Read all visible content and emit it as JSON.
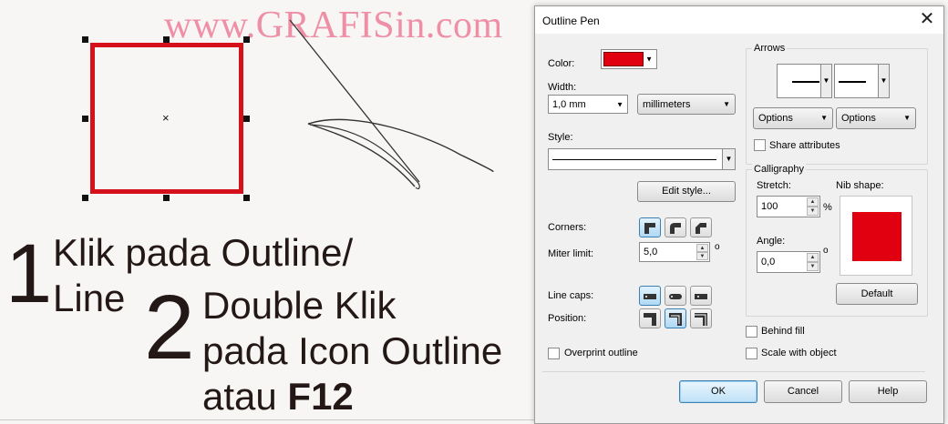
{
  "watermark": "www.GRAFISin.com",
  "tutorial": {
    "step1_number": "1",
    "step1_line1": "Klik pada Outline/",
    "step1_line2": "Line",
    "step2_number": "2",
    "step2_line1": "Double Klik",
    "step2_line2": "pada Icon Outline",
    "step2_line3_prefix": "atau ",
    "step2_line3_key": "F12",
    "center_mark": "×"
  },
  "dialog": {
    "title": "Outline Pen",
    "close_glyph": "✕",
    "color_label": "Color:",
    "color_value": "#e00010",
    "width_label": "Width:",
    "width_value": "1,0 mm",
    "units_value": "millimeters",
    "style_label": "Style:",
    "edit_style_button": "Edit style...",
    "corners_label": "Corners:",
    "miter_label": "Miter limit:",
    "miter_value": "5,0",
    "miter_unit": "o",
    "line_caps_label": "Line caps:",
    "position_label": "Position:",
    "overprint_label": "Overprint outline",
    "arrows_title": "Arrows",
    "options_left": "Options",
    "options_right": "Options",
    "share_attributes": "Share attributes",
    "calligraphy_title": "Calligraphy",
    "stretch_label": "Stretch:",
    "stretch_value": "100",
    "stretch_unit": "%",
    "nib_shape_label": "Nib shape:",
    "angle_label": "Angle:",
    "angle_value": "0,0",
    "angle_unit": "o",
    "default_button": "Default",
    "behind_fill": "Behind fill",
    "scale_with_object": "Scale with object",
    "ok_button": "OK",
    "cancel_button": "Cancel",
    "help_button": "Help"
  },
  "colors": {
    "outline_red": "#d5121b",
    "watermark_pink": "#ef8fa6",
    "text_dark": "#231815"
  }
}
